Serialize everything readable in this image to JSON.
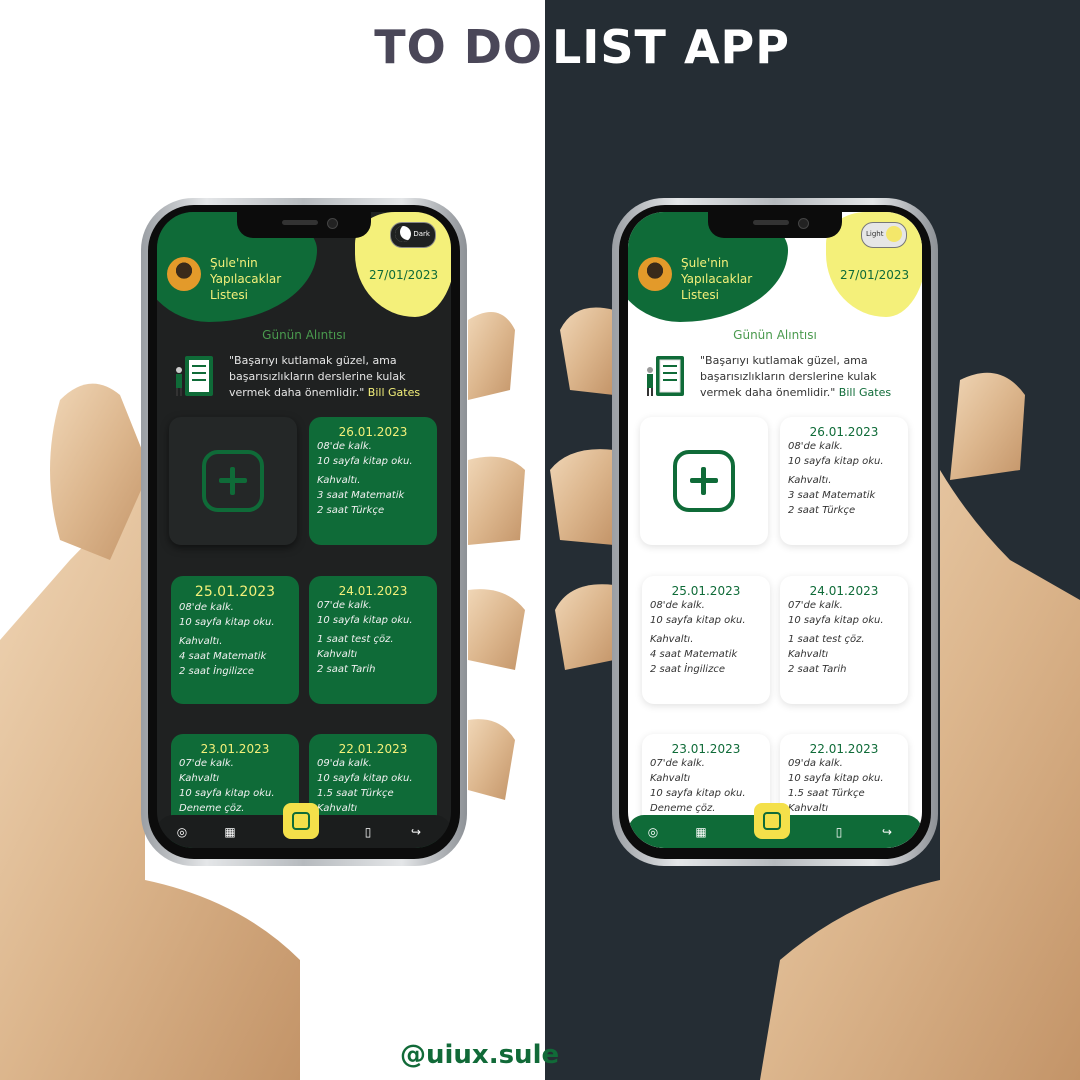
{
  "header": {
    "title_part1": "TO DO",
    "title_part2": "LIST APP"
  },
  "footer": {
    "handle": "@uiux.sule"
  },
  "colors": {
    "green": "#0f6b38",
    "yellow": "#f4f07a",
    "dark_bg": "#1f2121",
    "right_bg": "#252d34"
  },
  "phones": {
    "dark": {
      "toggle_label": "Dark",
      "owner": "Şule'nin Yapılacaklar Listesi",
      "date": "27/01/2023",
      "quote_title": "Günün Alıntısı",
      "quote": "\"Başarıyı kutlamak güzel, ama başarısızlıkların derslerine kulak vermek daha önemlidir.\"",
      "quote_author": "Bill Gates"
    },
    "light": {
      "toggle_label": "Light",
      "owner": "Şule'nin Yapılacaklar Listesi",
      "date": "27/01/2023",
      "quote_title": "Günün Alıntısı",
      "quote": "\"Başarıyı kutlamak güzel, ama başarısızlıkların derslerine kulak vermek daha önemlidir.\"",
      "quote_author": "Bill Gates"
    }
  },
  "cards": [
    {
      "date": "26.01.2023",
      "lines": [
        "08'de kalk.",
        "10 sayfa kitap oku.",
        "Kahvaltı.",
        "3 saat Matematik",
        "2 saat Türkçe"
      ]
    },
    {
      "date": "25.01.2023",
      "lines": [
        "08'de kalk.",
        "10 sayfa kitap oku.",
        "Kahvaltı.",
        "4 saat Matematik",
        "2 saat İngilizce"
      ]
    },
    {
      "date": "24.01.2023",
      "lines": [
        "07'de kalk.",
        "10 sayfa kitap oku.",
        "1 saat test çöz.",
        "Kahvaltı",
        "2 saat Tarih"
      ]
    },
    {
      "date": "23.01.2023",
      "lines": [
        "07'de kalk.",
        "Kahvaltı",
        "10 sayfa kitap oku.",
        "Deneme çöz."
      ]
    },
    {
      "date": "22.01.2023",
      "lines": [
        "09'da kalk.",
        "10 sayfa kitap oku.",
        "1.5 saat Türkçe",
        "Kahvaltı"
      ]
    }
  ],
  "nav": [
    "profile-icon",
    "calendar-icon",
    "notes-icon",
    "bookmark-icon",
    "logout-icon"
  ]
}
